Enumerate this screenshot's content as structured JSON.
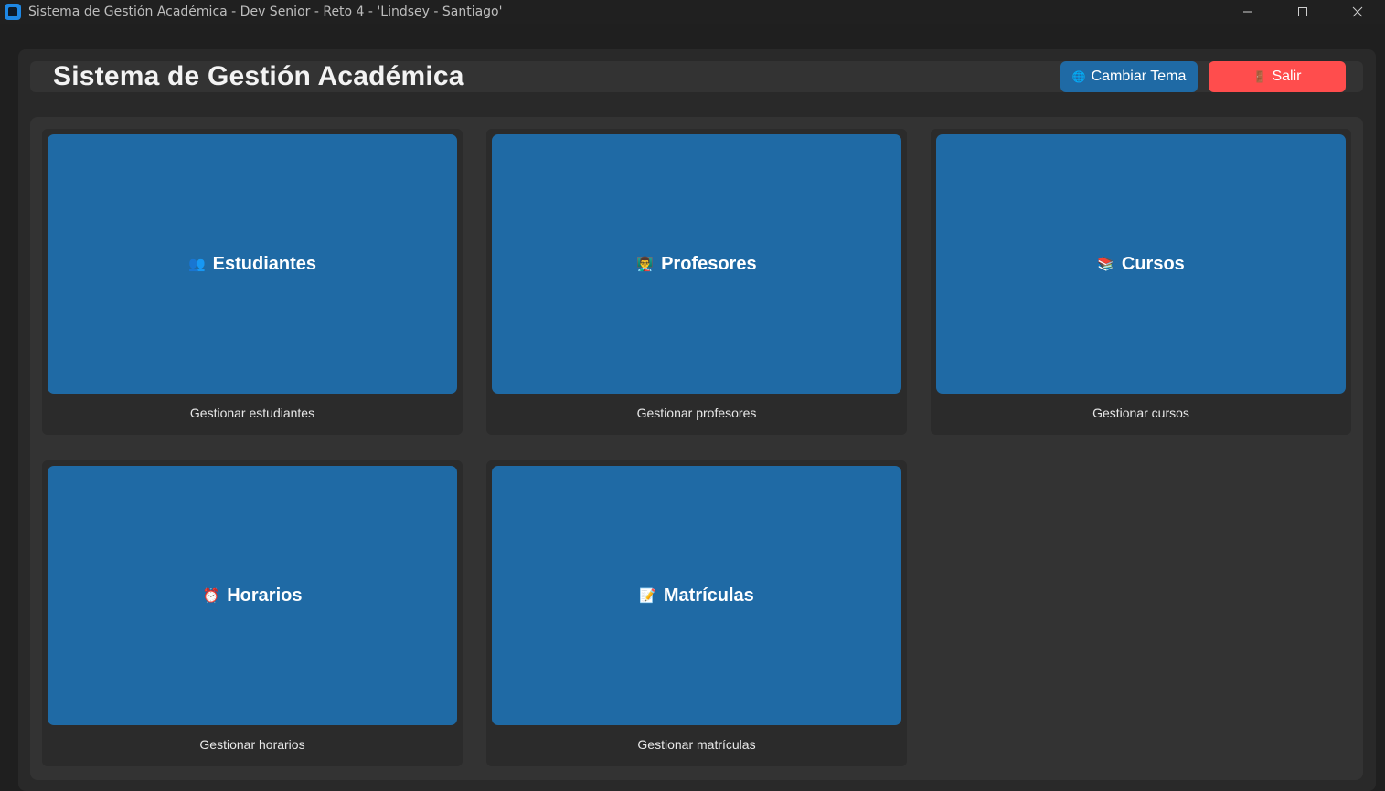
{
  "window": {
    "title": "Sistema de Gestión Académica - Dev Senior - Reto 4 - 'Lindsey - Santiago'"
  },
  "header": {
    "title": "Sistema de Gestión Académica",
    "theme_button": {
      "icon": "globe-icon",
      "icon_glyph": "🌐",
      "label": "Cambiar Tema"
    },
    "exit_button": {
      "icon": "door-icon",
      "icon_glyph": "🚪",
      "label": "Salir"
    }
  },
  "modules": [
    {
      "icon": "students-icon",
      "icon_glyph": "👥",
      "label": "Estudiantes",
      "description": "Gestionar estudiantes"
    },
    {
      "icon": "teacher-icon",
      "icon_glyph": "👨‍🏫",
      "label": "Profesores",
      "description": "Gestionar profesores"
    },
    {
      "icon": "books-icon",
      "icon_glyph": "📚",
      "label": "Cursos",
      "description": "Gestionar cursos"
    },
    {
      "icon": "alarm-clock-icon",
      "icon_glyph": "⏰",
      "label": "Horarios",
      "description": "Gestionar horarios"
    },
    {
      "icon": "enrollment-icon",
      "icon_glyph": "📝",
      "label": "Matrículas",
      "description": "Gestionar matrículas"
    }
  ],
  "colors": {
    "accent": "#1f6aa5",
    "danger": "#ff4d4d",
    "background": "#1f1f1f",
    "panel": "#333333"
  }
}
